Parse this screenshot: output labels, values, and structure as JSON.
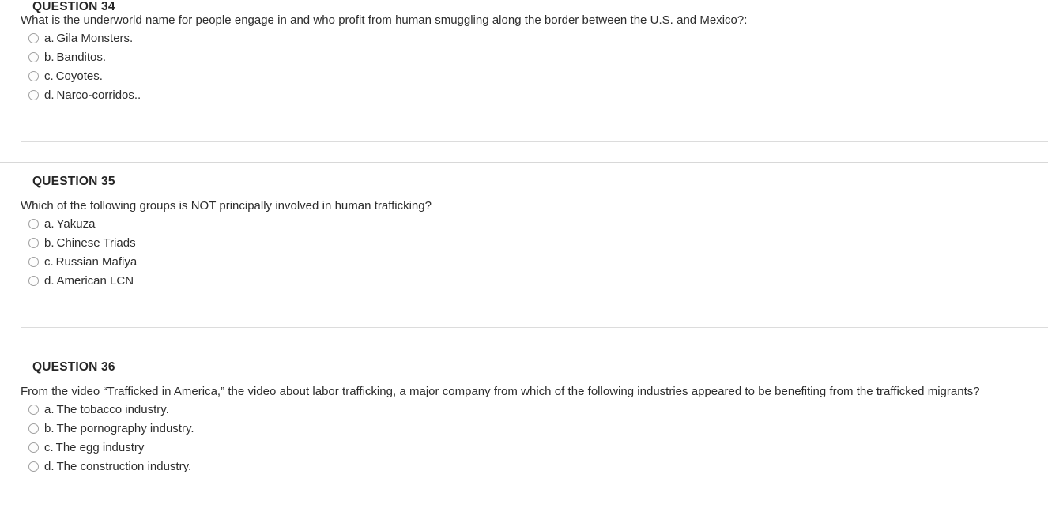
{
  "page": {
    "background_color": "#ffffff",
    "text_color": "#2d2d2d",
    "header_color": "#262626",
    "divider_color": "#dcdcdc",
    "radio_border_color": "#a0a0a0"
  },
  "questions": [
    {
      "header": "QUESTION 34",
      "header_clipped": true,
      "text": "What is the underworld name for people engage in and who profit from human smuggling along the border between the U.S. and Mexico?:",
      "options": [
        {
          "letter": "a.",
          "label": "Gila Monsters."
        },
        {
          "letter": "b.",
          "label": "Banditos."
        },
        {
          "letter": "c.",
          "label": "Coyotes."
        },
        {
          "letter": "d.",
          "label": "Narco-corridos.."
        }
      ]
    },
    {
      "header": "QUESTION 35",
      "header_clipped": false,
      "text": "Which of the following groups is NOT principally involved in human trafficking?",
      "options": [
        {
          "letter": "a.",
          "label": "Yakuza"
        },
        {
          "letter": "b.",
          "label": "Chinese Triads"
        },
        {
          "letter": "c.",
          "label": "Russian Mafiya"
        },
        {
          "letter": "d.",
          "label": "American LCN"
        }
      ]
    },
    {
      "header": "QUESTION 36",
      "header_clipped": false,
      "text": "From the video “Trafficked in America,” the video about labor trafficking,  a major company from which of the following industries appeared to be benefiting from the trafficked migrants?",
      "options": [
        {
          "letter": "a.",
          "label": "The tobacco industry."
        },
        {
          "letter": "b.",
          "label": "The pornography industry."
        },
        {
          "letter": "c.",
          "label": "The egg industry"
        },
        {
          "letter": "d.",
          "label": "The construction industry."
        }
      ]
    }
  ]
}
